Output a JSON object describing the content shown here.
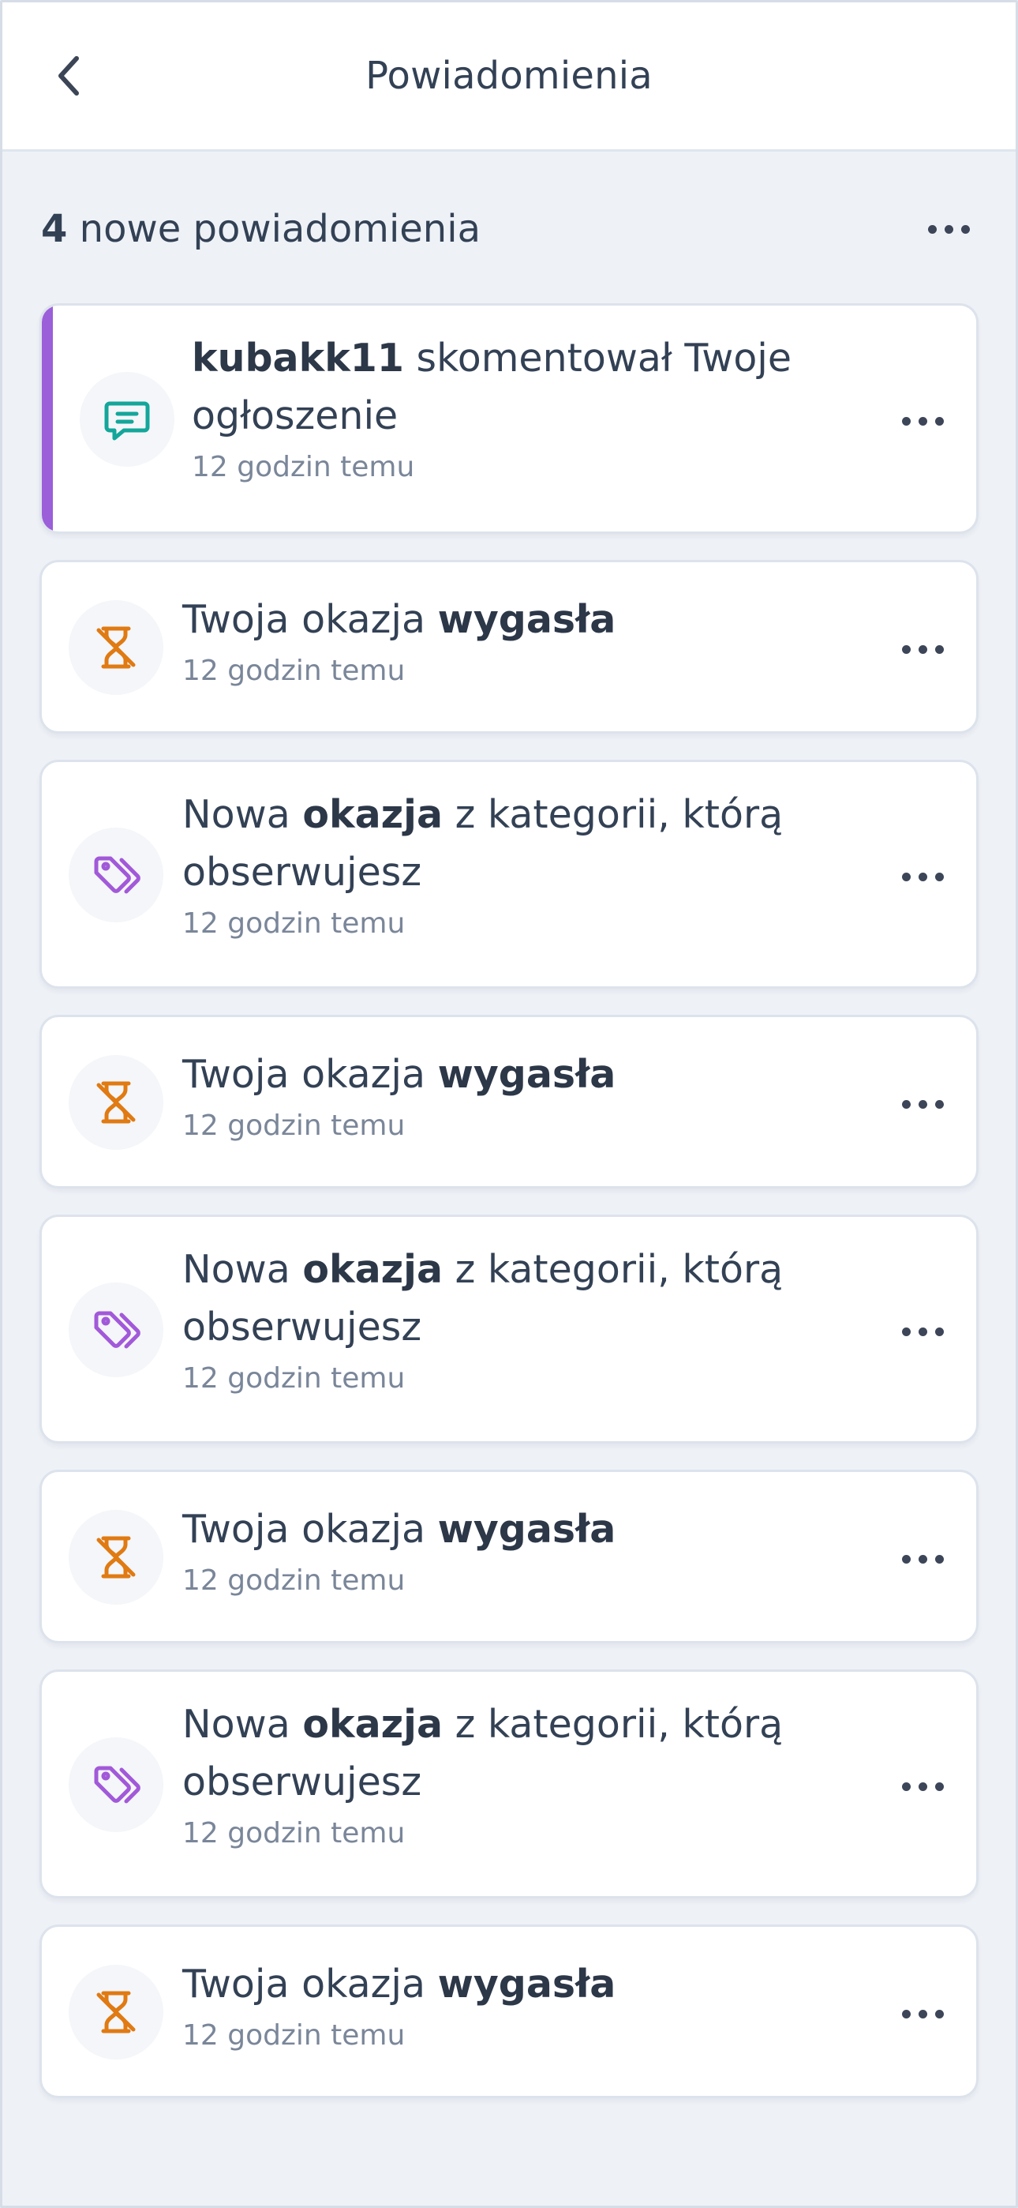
{
  "header": {
    "title": "Powiadomienia",
    "back_icon": "chevron-left-icon"
  },
  "summary": {
    "count": "4",
    "label": " nowe powiadomienia"
  },
  "colors": {
    "unread_accent": "#9b5fd9",
    "comment_icon": "#14a69a",
    "expired_icon": "#e07a12",
    "tag_icon": "#a259d9",
    "background": "#eef2f7"
  },
  "notifications": [
    {
      "type": "comment",
      "icon": "comment-icon",
      "unread": true,
      "parts": [
        "kubakk11",
        " skomentował Twoje ogłoszenie"
      ],
      "time": "12 godzin temu"
    },
    {
      "type": "expired",
      "icon": "hourglass-off-icon",
      "unread": false,
      "parts": [
        "Twoja okazja ",
        "wygasła"
      ],
      "time": "12 godzin temu"
    },
    {
      "type": "category",
      "icon": "tags-icon",
      "unread": false,
      "parts": [
        "Nowa ",
        "okazja",
        " z kategorii, którą obserwujesz"
      ],
      "time": "12 godzin temu"
    },
    {
      "type": "expired",
      "icon": "hourglass-off-icon",
      "unread": false,
      "parts": [
        "Twoja okazja ",
        "wygasła"
      ],
      "time": "12 godzin temu"
    },
    {
      "type": "category",
      "icon": "tags-icon",
      "unread": false,
      "parts": [
        "Nowa ",
        "okazja",
        " z kategorii, którą obserwujesz"
      ],
      "time": "12 godzin temu"
    },
    {
      "type": "expired",
      "icon": "hourglass-off-icon",
      "unread": false,
      "parts": [
        "Twoja okazja ",
        "wygasła"
      ],
      "time": "12 godzin temu"
    },
    {
      "type": "category",
      "icon": "tags-icon",
      "unread": false,
      "parts": [
        "Nowa ",
        "okazja",
        " z kategorii, którą obserwujesz"
      ],
      "time": "12 godzin temu"
    },
    {
      "type": "expired",
      "icon": "hourglass-off-icon",
      "unread": false,
      "parts": [
        "Twoja okazja ",
        "wygasła"
      ],
      "time": "12 godzin temu"
    }
  ]
}
